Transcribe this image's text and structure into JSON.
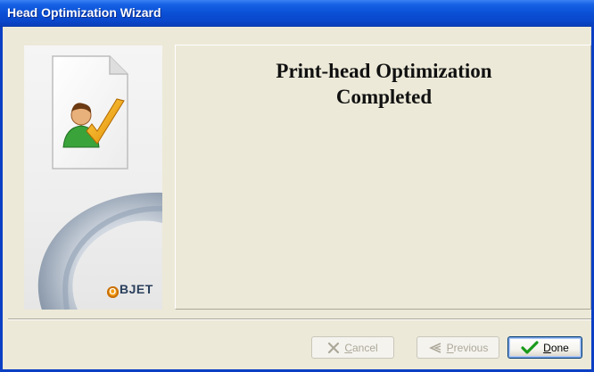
{
  "window": {
    "title": "Head Optimization Wizard"
  },
  "sidebar": {
    "brand": "BJET",
    "brand_o": "O",
    "icon": "user-checkmark-document-icon",
    "decoration": "swirl-logo"
  },
  "main": {
    "heading_line1": "Print-head Optimization",
    "heading_line2": "Completed"
  },
  "buttons": {
    "cancel": {
      "label": "ancel",
      "mnemonic": "C",
      "enabled": false,
      "icon": "x-icon"
    },
    "previous": {
      "label": "revious",
      "mnemonic": "P",
      "enabled": false,
      "icon": "back-arrow-icon"
    },
    "done": {
      "label": "one",
      "mnemonic": "D",
      "enabled": true,
      "icon": "checkmark-icon"
    }
  },
  "colors": {
    "titlebar": "#0b50d6",
    "dialog_bg": "#ece9d8",
    "check_green": "#1a9a1a",
    "brand_orange": "#f39c12"
  }
}
